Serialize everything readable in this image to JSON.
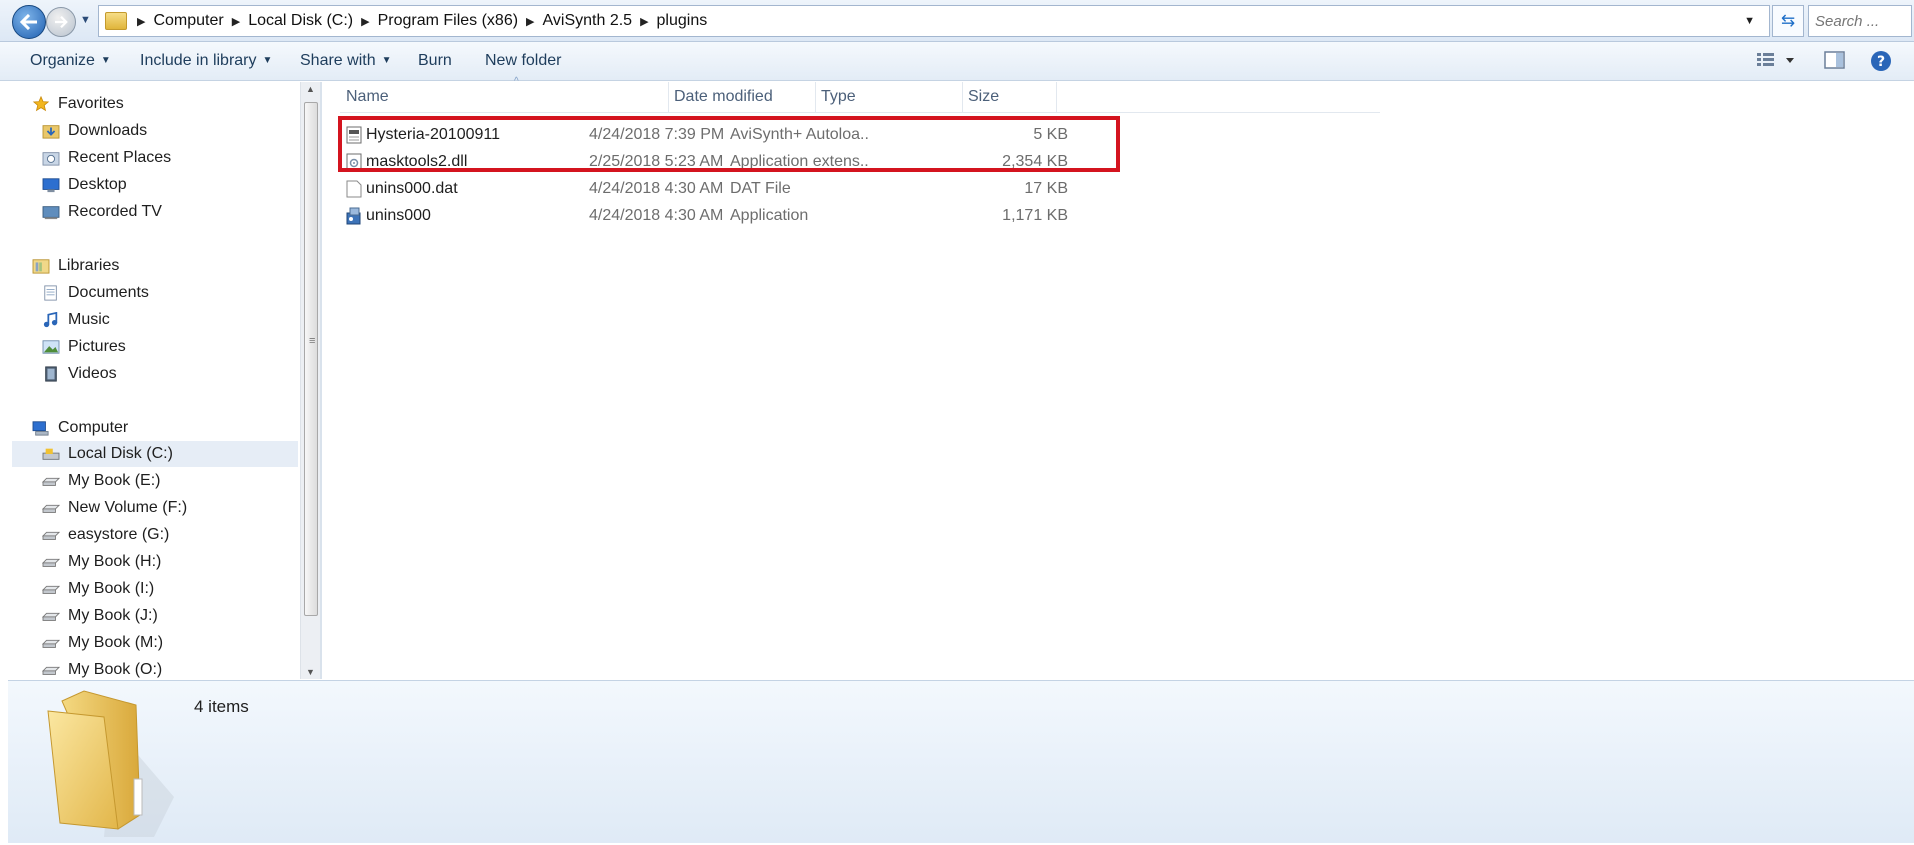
{
  "address": {
    "crumbs": [
      "Computer",
      "Local Disk (C:)",
      "Program Files (x86)",
      "AviSynth 2.5",
      "plugins"
    ],
    "search_placeholder": "Search ..."
  },
  "toolbar": {
    "organize": "Organize",
    "include": "Include in library",
    "share": "Share with",
    "burn": "Burn",
    "new_folder": "New folder"
  },
  "nav": {
    "favorites": {
      "label": "Favorites",
      "items": [
        "Downloads",
        "Recent Places",
        "Desktop",
        "Recorded TV"
      ]
    },
    "libraries": {
      "label": "Libraries",
      "items": [
        "Documents",
        "Music",
        "Pictures",
        "Videos"
      ]
    },
    "computer": {
      "label": "Computer",
      "selected": "Local Disk (C:)",
      "drives": [
        "Local Disk (C:)",
        "My Book (E:)",
        "New Volume (F:)",
        "easystore (G:)",
        "My Book (H:)",
        "My Book (I:)",
        "My Book (J:)",
        "My Book (M:)",
        "My Book (O:)"
      ]
    }
  },
  "columns": {
    "name": "Name",
    "date": "Date modified",
    "type": "Type",
    "size": "Size"
  },
  "files": [
    {
      "name": "Hysteria-20100911",
      "date": "4/24/2018 7:39 PM",
      "type": "AviSynth+ Autoloa...",
      "size": "5 KB",
      "icon": "script-file-icon"
    },
    {
      "name": "masktools2.dll",
      "date": "2/25/2018 5:23 AM",
      "type": "Application extens...",
      "size": "2,354 KB",
      "icon": "dll-file-icon"
    },
    {
      "name": "unins000.dat",
      "date": "4/24/2018 4:30 AM",
      "type": "DAT File",
      "size": "17 KB",
      "icon": "blank-file-icon"
    },
    {
      "name": "unins000",
      "date": "4/24/2018 4:30 AM",
      "type": "Application",
      "size": "1,171 KB",
      "icon": "installer-app-icon"
    }
  ],
  "status": {
    "count": "4 items"
  },
  "colors": {
    "highlight": "#d4141f",
    "accent": "#1f5fb0"
  }
}
